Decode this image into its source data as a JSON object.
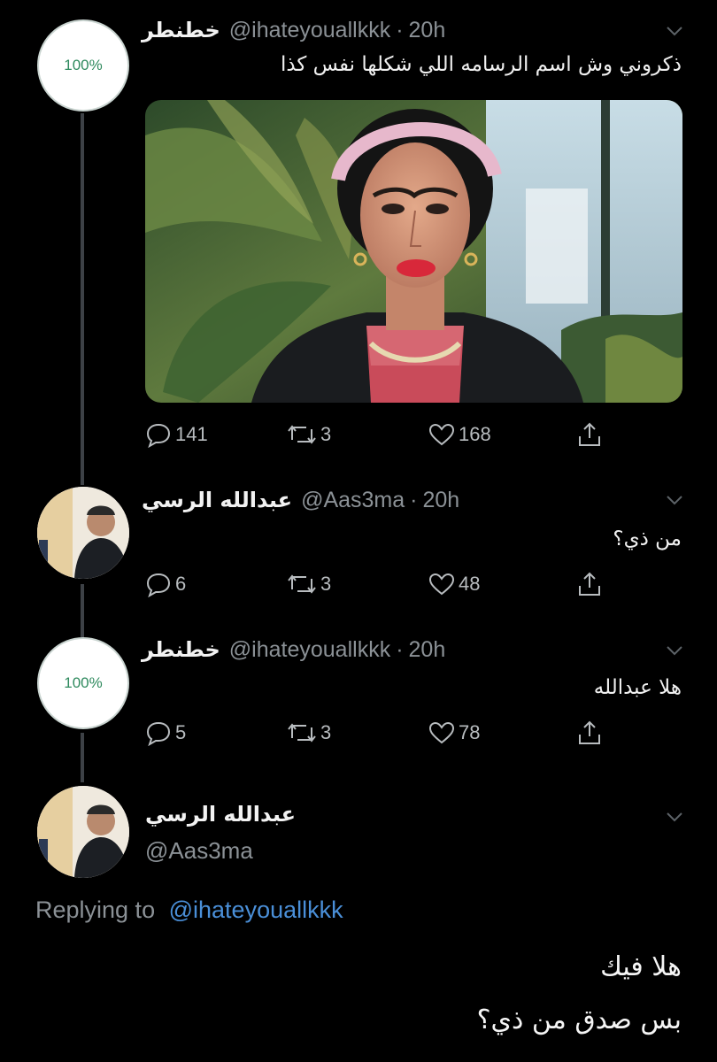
{
  "thread": [
    {
      "avatar_badge": "100%",
      "name": "خطنطر",
      "handle": "@ihateyouallkkk",
      "separator": "·",
      "time": "20h",
      "text": "ذكروني وش اسم الرسامه اللي شكلها نفس كذا",
      "replies": "141",
      "retweets": "3",
      "likes": "168"
    },
    {
      "name": "عبدالله الرسي",
      "handle": "@Aas3ma",
      "separator": "·",
      "time": "20h",
      "text": "من ذي؟",
      "replies": "6",
      "retweets": "3",
      "likes": "48"
    },
    {
      "avatar_badge": "100%",
      "name": "خطنطر",
      "handle": "@ihateyouallkkk",
      "separator": "·",
      "time": "20h",
      "text": "هلا عبدالله",
      "replies": "5",
      "retweets": "3",
      "likes": "78"
    }
  ],
  "focused": {
    "name": "عبدالله الرسي",
    "handle": "@Aas3ma",
    "replying_prefix": "Replying to",
    "replying_handle": "@ihateyouallkkk",
    "line1": "هلا فيك",
    "line2": "بس صدق من ذي؟"
  },
  "colors": {
    "background": "#000000",
    "link": "#4a8fd8",
    "muted": "#8b9196"
  }
}
